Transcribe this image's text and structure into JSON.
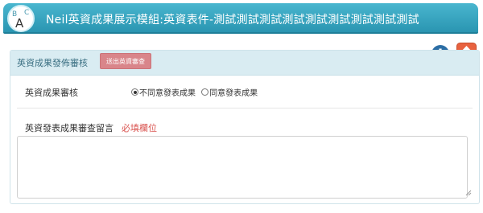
{
  "header": {
    "title": "Neil英資成果展示模組:英資表件-測試測試測試測試測試測試測試測試測試",
    "logo": "abc-logo",
    "color": "#2a95b1"
  },
  "actions": {
    "add_icon": "plus-circle-icon",
    "up_icon": "arrow-up-icon",
    "add_color": "#2c6ea5",
    "up_color": "#e8623f"
  },
  "panel": {
    "title": "英資成果發佈審核",
    "reject_button": "送出英資審查"
  },
  "form": {
    "review_label": "英資成果審核",
    "options": [
      "不同意發表成果",
      "同意發表成果"
    ],
    "selected_option": "不同意發表成果",
    "message_label": "英資發表成果審查留言",
    "required_text": "必填欄位",
    "message_value": ""
  }
}
